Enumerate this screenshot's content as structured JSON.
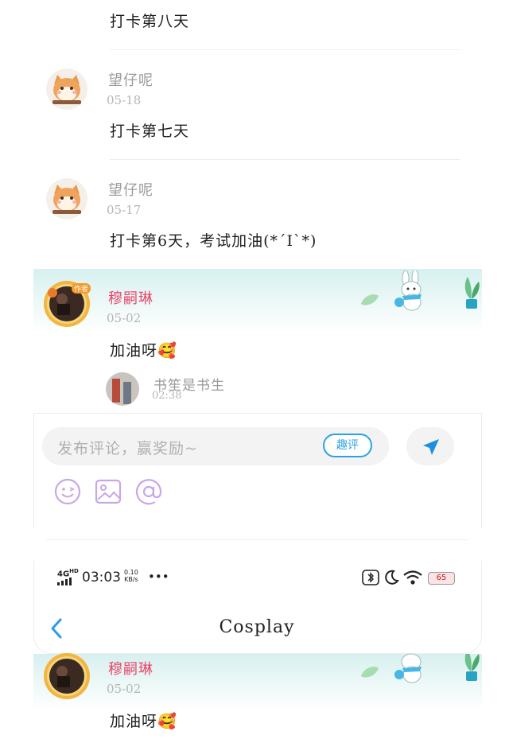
{
  "comments": [
    {
      "text": "打卡第八天"
    },
    {
      "user": "望仔呢",
      "date": "05-18",
      "text": "打卡第七天"
    },
    {
      "user": "望仔呢",
      "date": "05-17",
      "text": "打卡第6天，考试加油(*´I`*)"
    },
    {
      "user": "穆嗣琳",
      "date": "05-02",
      "text": "加油呀",
      "emoji": "🥰",
      "reply": {
        "user": "书笙是书生",
        "time": "02:38"
      }
    }
  ],
  "badge_label": "作者",
  "composer": {
    "placeholder": "发布评论，赢奖励~",
    "quping_label": "趣评",
    "icons": [
      "emoji-icon",
      "image-icon",
      "at-icon"
    ],
    "send_icon": "send-icon"
  },
  "embedded_screenshot": {
    "status": {
      "network": "4G",
      "network_sup": "HD",
      "time": "03:03",
      "speed_value": "0.10",
      "speed_unit": "KB/s",
      "dots": "•••",
      "battery": "65"
    },
    "title": "Cosplay",
    "back_icon": "chevron-left-icon"
  },
  "repeat_comment": {
    "user": "穆嗣琳",
    "date": "05-02",
    "text": "加油呀",
    "emoji": "🥰"
  },
  "colors": {
    "accent": "#2aa3e3",
    "pink_name": "#e8476b",
    "banner": "#d6f0ef",
    "tool_icon": "#c9a6ea"
  }
}
